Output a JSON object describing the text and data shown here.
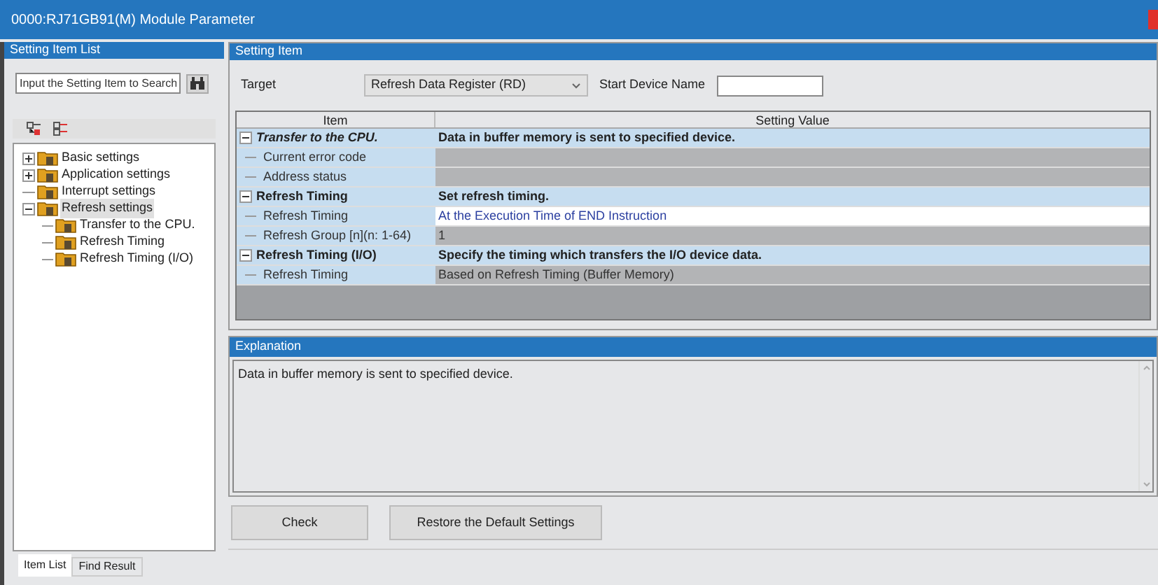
{
  "window": {
    "title": "0000:RJ71GB91(M) Module Parameter"
  },
  "sidebar": {
    "title": "Setting Item List",
    "search": {
      "placeholder": "Input the Setting Item to Search"
    },
    "tree": [
      {
        "label": "Basic settings",
        "expanded": false,
        "selected": false
      },
      {
        "label": "Application settings",
        "expanded": false,
        "selected": false
      },
      {
        "label": "Interrupt settings",
        "selected": false
      },
      {
        "label": "Refresh settings",
        "expanded": true,
        "selected": true,
        "children": [
          {
            "label": "Transfer to the CPU.",
            "selected": false
          },
          {
            "label": "Refresh Timing",
            "selected": false
          },
          {
            "label": "Refresh Timing (I/O)",
            "selected": false
          }
        ]
      }
    ],
    "tabs": [
      {
        "label": "Item List",
        "selected": true
      },
      {
        "label": "Find Result",
        "selected": false
      }
    ]
  },
  "setting": {
    "title": "Setting Item",
    "target_label": "Target",
    "target_value": "Refresh Data Register (RD)",
    "start_label": "Start Device Name",
    "columns": [
      "Item",
      "Setting Value"
    ],
    "groups": [
      {
        "label": "Transfer to the CPU.",
        "italic": true,
        "expanded": true,
        "value": "Data in buffer memory is sent to specified device.",
        "rows": [
          {
            "label": "Current error code",
            "editable": false
          },
          {
            "label": "Address status",
            "editable": false
          }
        ]
      },
      {
        "label": "Refresh Timing",
        "italic": false,
        "expanded": true,
        "value": "Set refresh timing.",
        "rows": [
          {
            "label": "Refresh Timing",
            "value": "At the Execution Time of END Instruction",
            "editable": true
          },
          {
            "label": "Refresh Group [n](n: 1-64)",
            "value": "1",
            "editable": false
          }
        ]
      },
      {
        "label": "Refresh Timing (I/O)",
        "italic": false,
        "expanded": true,
        "value": "Specify the timing which transfers the I/O device data.",
        "rows": [
          {
            "label": "Refresh Timing",
            "value": "Based on Refresh Timing (Buffer Memory)",
            "editable": false
          }
        ]
      }
    ]
  },
  "explanation": {
    "title": "Explanation",
    "text": "Data in buffer memory is sent to specified device."
  },
  "buttons": [
    "Check",
    "Restore the Default Settings"
  ]
}
